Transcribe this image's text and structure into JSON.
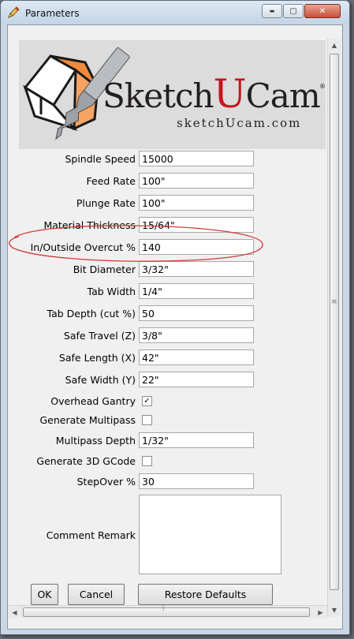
{
  "window": {
    "title": "Parameters"
  },
  "titlebar_controls": {
    "minimize": "▬",
    "maximize": "▢",
    "close": "✕"
  },
  "logo": {
    "wordmark_prefix": "Sketch",
    "wordmark_u": "U",
    "wordmark_suffix": "Cam",
    "trademark": "®",
    "url": "sketchUcam.com"
  },
  "fields": [
    {
      "label": "Spindle Speed",
      "value": "15000"
    },
    {
      "label": "Feed Rate",
      "value": "100\""
    },
    {
      "label": "Plunge Rate",
      "value": "100\""
    },
    {
      "label": "Material Thickness",
      "value": "15/64\""
    },
    {
      "label": "In/Outside Overcut %",
      "value": "140"
    },
    {
      "label": "Bit Diameter",
      "value": "3/32\""
    },
    {
      "label": "Tab Width",
      "value": "1/4\""
    },
    {
      "label": "Tab Depth (cut %)",
      "value": "50"
    },
    {
      "label": "Safe Travel (Z)",
      "value": "3/8\""
    },
    {
      "label": "Safe Length (X)",
      "value": "42\""
    },
    {
      "label": "Safe Width (Y)",
      "value": "22\""
    }
  ],
  "checkboxes": {
    "overhead_gantry": {
      "label": "Overhead Gantry",
      "checked": true,
      "mark": "✓"
    },
    "generate_multipass": {
      "label": "Generate Multipass",
      "checked": false,
      "mark": ""
    },
    "generate_3d_gcode": {
      "label": "Generate 3D GCode",
      "checked": false,
      "mark": ""
    }
  },
  "multipass_depth": {
    "label": "Multipass Depth",
    "value": "1/32\""
  },
  "stepover": {
    "label": "StepOver %",
    "value": "30"
  },
  "comment": {
    "label": "Comment Remark",
    "value": ""
  },
  "buttons": {
    "ok": "OK",
    "cancel": "Cancel",
    "restore": "Restore Defaults"
  },
  "annotation": {
    "color": "#d4373a"
  },
  "colors": {
    "logo_red": "#c4161c",
    "logo_dark": "#231f20"
  }
}
